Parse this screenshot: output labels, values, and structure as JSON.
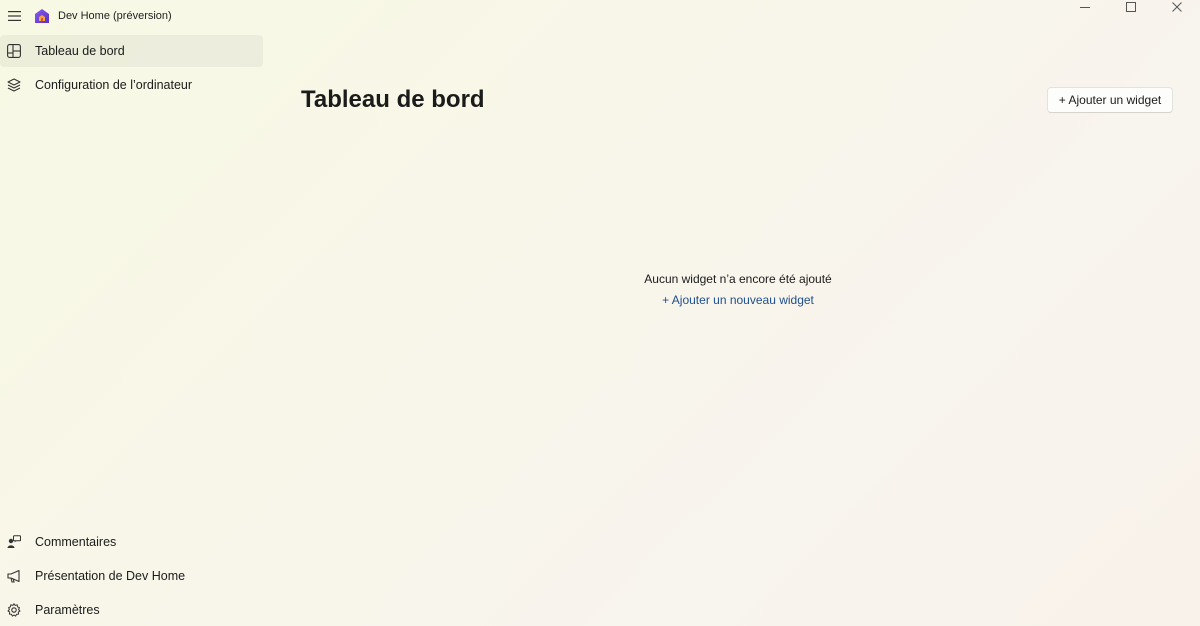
{
  "window": {
    "title": "Dev Home (préversion)"
  },
  "sidebar": {
    "items": [
      {
        "label": "Tableau de bord",
        "icon": "dashboard-icon"
      },
      {
        "label": "Configuration de l’ordinateur",
        "icon": "layers-icon"
      }
    ],
    "footer_items": [
      {
        "label": "Commentaires",
        "icon": "feedback-icon"
      },
      {
        "label": "Présentation de Dev Home",
        "icon": "megaphone-icon"
      },
      {
        "label": "Paramètres",
        "icon": "gear-icon"
      }
    ]
  },
  "main": {
    "title": "Tableau de bord",
    "add_widget_label": "+ Ajouter un widget",
    "empty_message": "Aucun widget n’a encore été ajouté",
    "empty_link": "+ Ajouter un nouveau widget"
  },
  "colors": {
    "accent_link": "#1e4e8f",
    "background": "#f8f6e9"
  }
}
